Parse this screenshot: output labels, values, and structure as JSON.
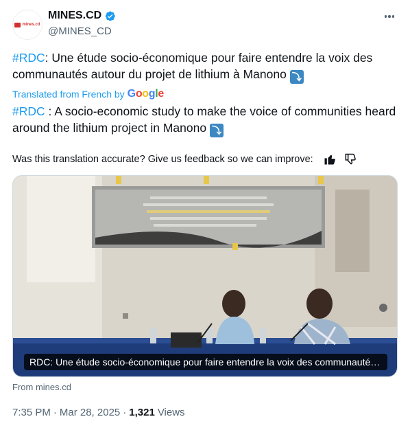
{
  "account": {
    "display_name": "MINES.CD",
    "handle": "@MINES_CD",
    "avatar_text": "mines.cd",
    "verified_icon": "verified-badge-icon",
    "brand_color": "#d3302f"
  },
  "tweet": {
    "hashtag": "#RDC",
    "text": ": Une étude socio-économique pour faire entendre la voix des communautés autour du projet de lithium à Manono",
    "emoji": "⤵"
  },
  "translation_label": {
    "prefix": "Translated from French by",
    "brand": "Google"
  },
  "translation": {
    "hashtag": "#RDC",
    "text": " : A socio-economic study to make the voice of communities heard around the lithium project in Manono",
    "emoji": "⤵"
  },
  "feedback": {
    "question": "Was this translation accurate? Give us feedback so we can improve:",
    "thumbs_up_icon": "thumbs-up-icon",
    "thumbs_down_icon": "thumbs-down-icon"
  },
  "media": {
    "caption": "RDC: Une étude socio-économique pour faire entendre la voix des communautés autour du projet de lithium à Manono",
    "source": "From mines.cd"
  },
  "meta": {
    "time": "7:35 PM",
    "separator": "·",
    "date": "Mar 28, 2025",
    "views_count": "1,321",
    "views_label": "Views"
  },
  "colors": {
    "link": "#1d9bf0",
    "secondary_text": "#536471",
    "primary_text": "#0f1419"
  }
}
